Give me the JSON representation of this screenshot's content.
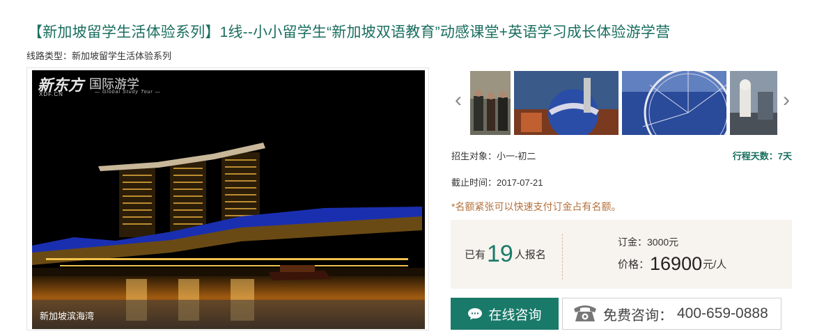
{
  "header": {
    "title": "【新加坡留学生活体验系列】1线--小小留学生“新加坡双语教育”动感课堂+英语学习成长体验游学营",
    "route_type": "线路类型：新加坡留学生活体验系列"
  },
  "gallery": {
    "main_caption": "新加坡滨海湾",
    "logo_main": "新东方",
    "logo_main_sub": "XDF.CN",
    "logo_secondary": "国际游学",
    "logo_secondary_sub": "— Global Study Tour —",
    "prev_icon": "chevron-left-icon",
    "next_icon": "chevron-right-icon"
  },
  "details": {
    "recruit_target": "招生对象：小一-初二",
    "duration": "行程天数：7天",
    "deadline": "截止时间：2017-07-21",
    "notice": "*名额紧张可以快速支付订金占有名额。"
  },
  "pricing": {
    "enrolled_prefix": "已有",
    "enrolled_count": "19",
    "enrolled_suffix": "人报名",
    "deposit": "订金：3000元",
    "price_label": "价格：",
    "price_value": "16900",
    "price_unit": "元/人"
  },
  "actions": {
    "consult_label": "在线咨询",
    "phone_label": "免费咨询：",
    "phone_number": "400-659-0888"
  },
  "colors": {
    "brand_green": "#1a7a6a",
    "title_green": "#1a6e5f",
    "notice_orange": "#b5713c",
    "price_bg": "#f7f3ee"
  }
}
